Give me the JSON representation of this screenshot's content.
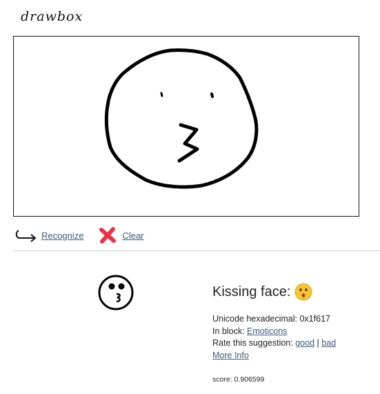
{
  "app": {
    "title": "drawbox"
  },
  "toolbar": {
    "recognize_label": "Recognize",
    "clear_label": "Clear",
    "recognize_icon": "hook-arrow-right-icon",
    "clear_icon": "red-x-icon"
  },
  "result": {
    "glyph_icon": "kissing-face-outline-icon",
    "title": "Kissing face:",
    "emoji_icon": "kissing-face-emoji-icon",
    "unicode_label": "Unicode hexadecimal:",
    "unicode_value": "0x1f617",
    "block_label": "In block:",
    "block_value": "Emoticons",
    "rate_label": "Rate this suggestion:",
    "rate_good": "good",
    "rate_separator": "|",
    "rate_bad": "bad",
    "more_info": "More Info ",
    "score": "score: 0.906599"
  },
  "colors": {
    "link": "#3c5a78",
    "clear_x": "#e8334a",
    "emoji_yellow": "#f7c531"
  }
}
